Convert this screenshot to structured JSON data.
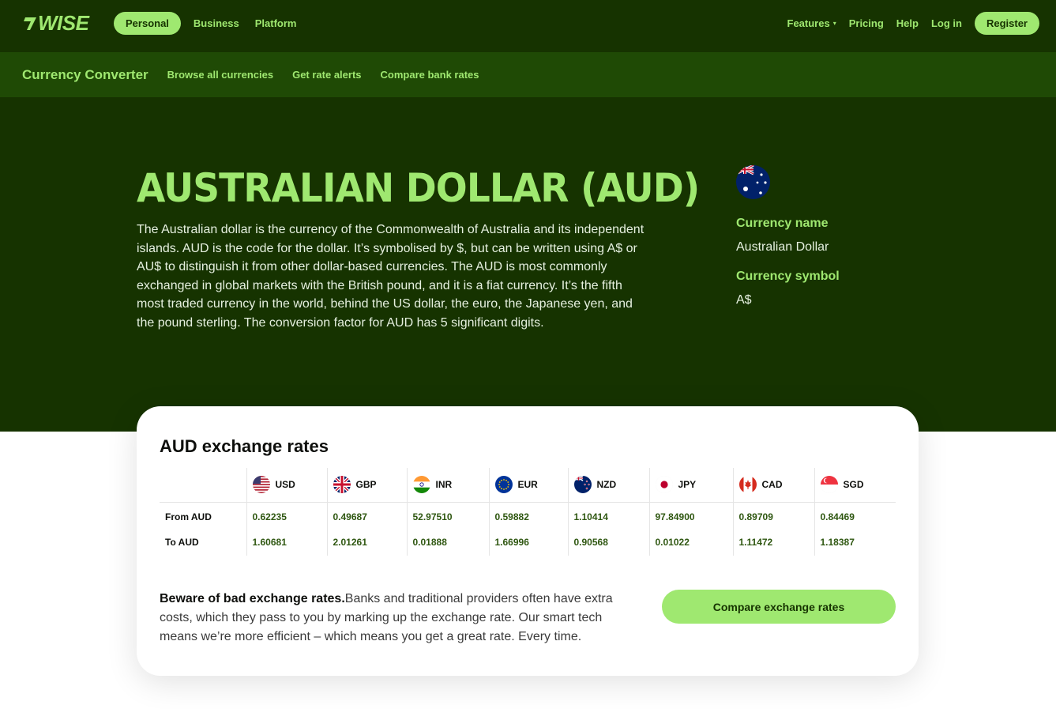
{
  "header": {
    "logo_text": "WISE",
    "nav_left": [
      "Personal",
      "Business",
      "Platform"
    ],
    "features": "Features",
    "pricing": "Pricing",
    "help": "Help",
    "login": "Log in",
    "register": "Register"
  },
  "subnav": {
    "title": "Currency Converter",
    "links": [
      "Browse all currencies",
      "Get rate alerts",
      "Compare bank rates"
    ]
  },
  "hero": {
    "title": "AUSTRALIAN DOLLAR (AUD)",
    "description": "The Australian dollar is the currency of the Commonwealth of Australia and its independent islands. AUD is the code for the dollar. It’s symbolised by $, but can be written using A$ or AU$ to distinguish it from other dollar-based currencies. The AUD is most commonly exchanged in global markets with the British pound, and it is a fiat currency. It’s the fifth most traded currency in the world, behind the US dollar, the euro, the Japanese yen, and the pound sterling. The conversion factor for AUD has 5 significant digits.",
    "name_label": "Currency name",
    "name_value": "Australian Dollar",
    "symbol_label": "Currency symbol",
    "symbol_value": "A$"
  },
  "rates": {
    "title": "AUD exchange rates",
    "currencies": [
      "USD",
      "GBP",
      "INR",
      "EUR",
      "NZD",
      "JPY",
      "CAD",
      "SGD"
    ],
    "flags": [
      "us-flag-icon",
      "gb-flag-icon",
      "in-flag-icon",
      "eu-flag-icon",
      "nz-flag-icon",
      "jp-flag-icon",
      "ca-flag-icon",
      "sg-flag-icon"
    ],
    "from_label": "From AUD",
    "to_label": "To AUD",
    "from": [
      "0.62235",
      "0.49687",
      "52.97510",
      "0.59882",
      "1.10414",
      "97.84900",
      "0.89709",
      "0.84469"
    ],
    "to": [
      "1.60681",
      "2.01261",
      "0.01888",
      "1.66996",
      "0.90568",
      "0.01022",
      "1.11472",
      "1.18387"
    ]
  },
  "beware": {
    "bold": "Beware of bad exchange rates.",
    "text": "Banks and traditional providers often have extra costs, which they pass to you by marking up the exchange rate. Our smart tech means we’re more efficient – which means you get a great rate. Every time.",
    "button": "Compare exchange rates"
  },
  "colors": {
    "forest": "#163300",
    "bright_green": "#9fe870",
    "subbar": "#1f4a05"
  }
}
